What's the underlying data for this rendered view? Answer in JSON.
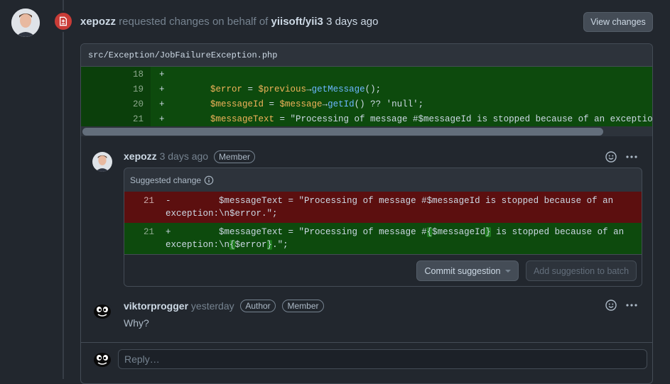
{
  "header": {
    "reviewer": "xepozz",
    "action_text": "requested changes on behalf of",
    "org": "yiisoft/yii3",
    "time": "3 days ago",
    "view_changes_label": "View changes"
  },
  "file": {
    "path": "src/Exception/JobFailureException.php",
    "lines": [
      {
        "num": "18",
        "sign": "+"
      },
      {
        "num": "19",
        "sign": "+"
      },
      {
        "num": "20",
        "sign": "+"
      },
      {
        "num": "21",
        "sign": "+"
      }
    ],
    "code_19": {
      "a": "$error",
      "b": " = ",
      "c": "$previous",
      "d": "→",
      "e": "getMessage",
      "f": "();"
    },
    "code_20": {
      "a": "$messageId",
      "b": " = ",
      "c": "$message",
      "d": "→",
      "e": "getId",
      "f": "() ?? 'null';"
    },
    "code_21": {
      "a": "$messageText",
      "b": " = \"Processing of message #$messageId is stopped because of an exception:\\n"
    }
  },
  "comment1": {
    "author": "xepozz",
    "time": "3 days ago",
    "badge": "Member",
    "suggest_title": "Suggested change",
    "del_num": "21",
    "del_sign": "-",
    "del_line1": "$messageText = \"Processing of message #$messageId is stopped because of an",
    "del_line2": "exception:\\n$error.\";",
    "add_num": "21",
    "add_sign": "+",
    "add_line1_a": "$messageText = \"Processing of message #",
    "add_line1_b": "{",
    "add_line1_c": "$messageId",
    "add_line1_d": "}",
    "add_line1_e": " is stopped because of an",
    "add_line2_a": "exception:\\n",
    "add_line2_b": "{",
    "add_line2_c": "$error",
    "add_line2_d": "}",
    "add_line2_e": ".\";",
    "commit_label": "Commit suggestion",
    "batch_label": "Add suggestion to batch"
  },
  "comment2": {
    "author": "viktorprogger",
    "time": "yesterday",
    "badge_author": "Author",
    "badge_member": "Member",
    "body": "Why?"
  },
  "reply": {
    "placeholder": "Reply…"
  },
  "colors": {
    "background": "#22272e",
    "added_line": "#0d4a0d",
    "deleted_line": "#5c0f0f",
    "changes_requested": "#c93c37"
  }
}
